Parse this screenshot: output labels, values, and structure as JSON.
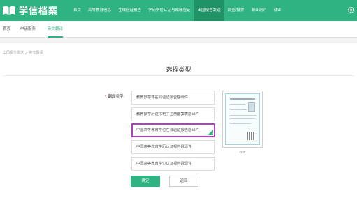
{
  "app": {
    "logo_text": "学信档案"
  },
  "nav": {
    "items": [
      {
        "label": "首页",
        "active": false
      },
      {
        "label": "高等教育信息",
        "active": false
      },
      {
        "label": "在线验证报告",
        "active": false
      },
      {
        "label": "学历学位认证与成绩验证",
        "active": false
      },
      {
        "label": "出国报告发送",
        "active": true
      },
      {
        "label": "调查/投票",
        "active": false
      },
      {
        "label": "职业测评",
        "active": false
      },
      {
        "label": "就业",
        "active": false
      }
    ],
    "settings_icon": "gear-icon"
  },
  "subnav": {
    "tabs": [
      {
        "label": "首页",
        "active": false
      },
      {
        "label": "申请服务",
        "active": false
      },
      {
        "label": "英文翻译",
        "active": true
      }
    ]
  },
  "breadcrumb": "出国报告发送 > 英文翻译",
  "section_title": "选择类型",
  "form": {
    "label": "翻译类型:",
    "required_mark": "*",
    "options": [
      {
        "label": "教育部学籍在线验证报告翻译件",
        "selected": false
      },
      {
        "label": "教育部学历证书电子注册备案表翻译件",
        "selected": false
      },
      {
        "label": "中国高等教育学位在线验证报告翻译件",
        "selected": true
      },
      {
        "label": "中国高等教育学历认证报告翻译件",
        "selected": false
      },
      {
        "label": "中国高等教育学位认证报告翻译件",
        "selected": false
      }
    ],
    "preview_caption": "样本"
  },
  "buttons": {
    "confirm": "确定",
    "back": "返回"
  },
  "colors": {
    "brand": "#2fb380",
    "highlight_border": "#b23fc1"
  }
}
